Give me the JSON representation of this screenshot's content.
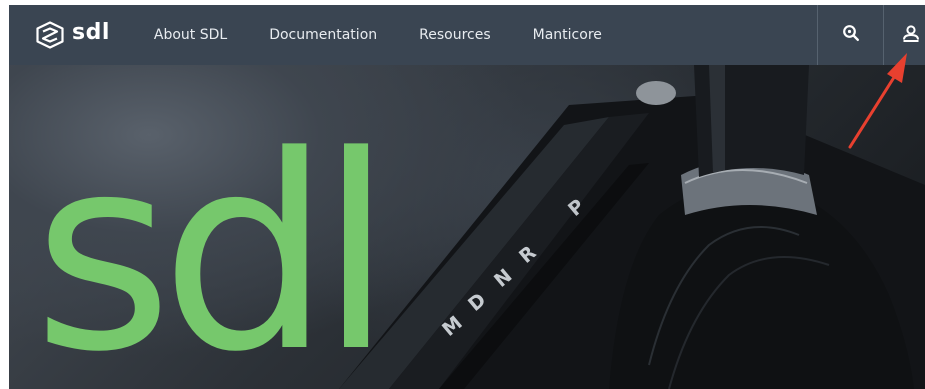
{
  "logo": {
    "text": "sdl",
    "icon": "sdl-logo-icon"
  },
  "nav": {
    "links": [
      "About SDL",
      "Documentation",
      "Resources",
      "Manticore"
    ],
    "search_icon": "search-icon",
    "account_icon": "user-icon"
  },
  "hero": {
    "wordmark": "sdl",
    "gear_letters": [
      "P",
      "R",
      "N",
      "D",
      "M"
    ],
    "accent_color": "#76c86c"
  },
  "annotation": {
    "type": "red-arrow",
    "color": "#e8402f"
  },
  "colors": {
    "navbar": "#3a4552",
    "accent": "#76c86c",
    "arrow": "#e8402f"
  }
}
